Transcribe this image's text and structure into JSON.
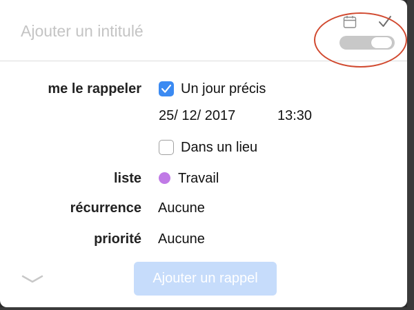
{
  "header": {
    "title_placeholder": "Ajouter un intitulé",
    "toggle_on": false
  },
  "form": {
    "remind_label": "me le rappeler",
    "on_day_label": "Un jour précis",
    "on_day_checked": true,
    "date": "25/ 12/ 2017",
    "time": "13:30",
    "at_location_label": "Dans un lieu",
    "at_location_checked": false,
    "list_label": "liste",
    "list_value": "Travail",
    "list_color": "#c07ae6",
    "recurrence_label": "récurrence",
    "recurrence_value": "Aucune",
    "priority_label": "priorité",
    "priority_value": "Aucune"
  },
  "footer": {
    "add_button_label": "Ajouter un rappel",
    "add_button_color": "#c6dcfb"
  },
  "colors": {
    "accent": "#3b8af2",
    "highlight_ring": "#d1492f"
  },
  "icons": [
    "calendar-icon",
    "checkmark-icon",
    "checkbox-check-icon",
    "chevron-down-icon"
  ]
}
